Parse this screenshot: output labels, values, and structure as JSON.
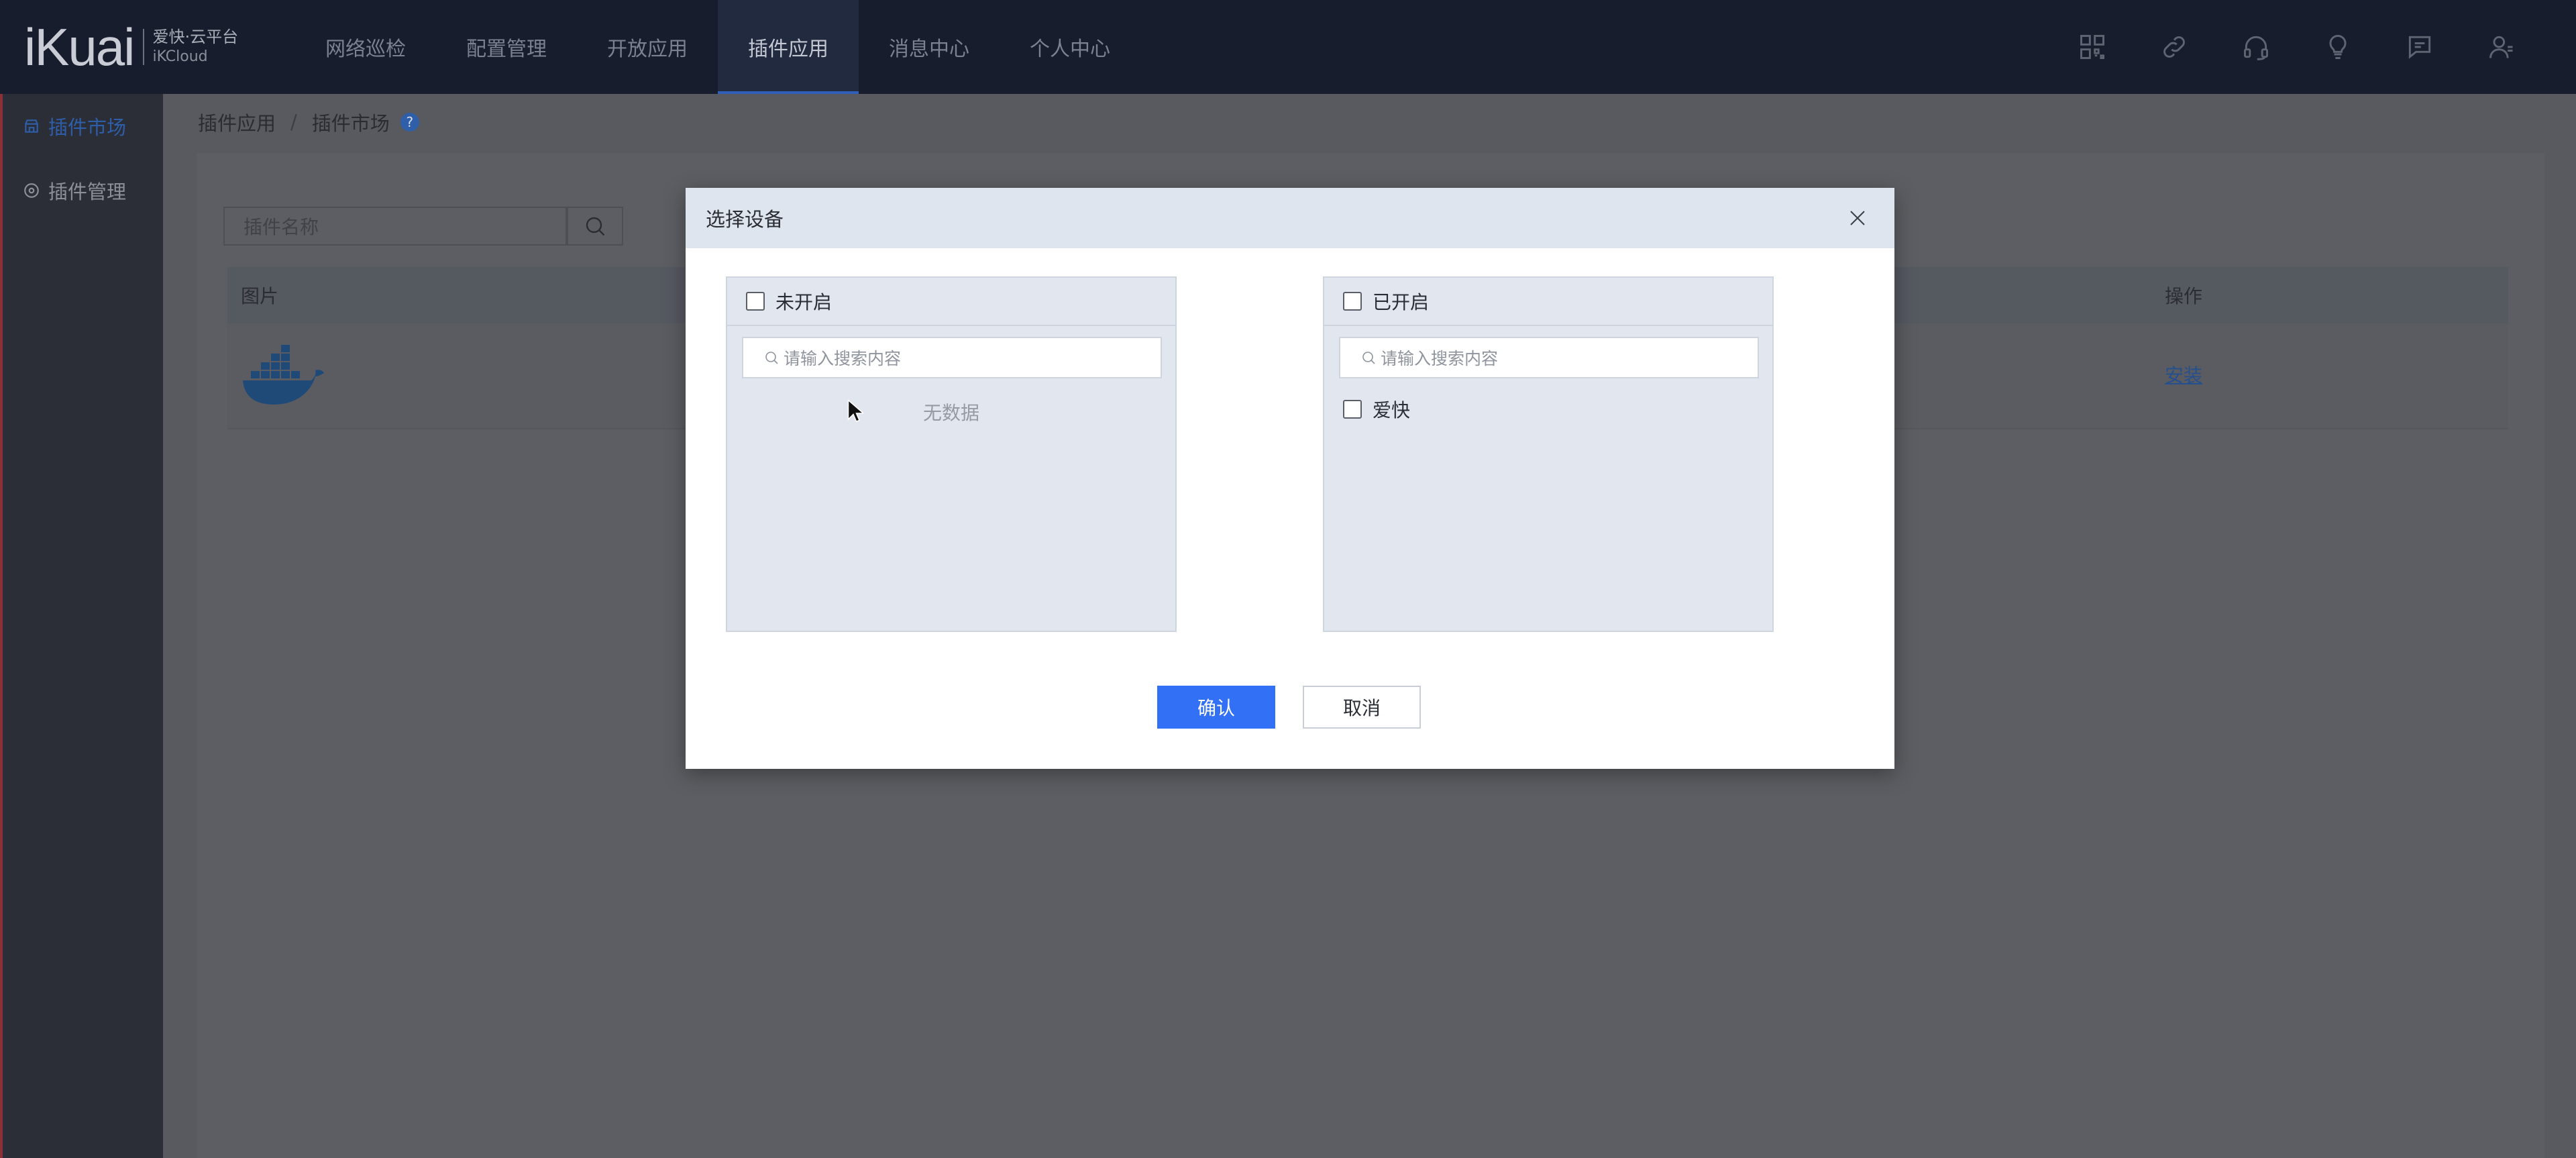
{
  "brand": {
    "logo_text": "iKuai",
    "name_cn": "爱快·云平台",
    "name_en": "iKCloud"
  },
  "nav": {
    "items": [
      {
        "label": "网络巡检",
        "active": false
      },
      {
        "label": "配置管理",
        "active": false
      },
      {
        "label": "开放应用",
        "active": false
      },
      {
        "label": "插件应用",
        "active": true
      },
      {
        "label": "消息中心",
        "active": false
      },
      {
        "label": "个人中心",
        "active": false
      }
    ],
    "icons": [
      "apps-grid-icon",
      "link-icon",
      "headset-icon",
      "lightbulb-icon",
      "message-icon",
      "user-icon"
    ]
  },
  "sidebar": {
    "items": [
      {
        "label": "插件市场",
        "icon": "market-icon",
        "active": true
      },
      {
        "label": "插件管理",
        "icon": "settings-icon",
        "active": false
      }
    ]
  },
  "breadcrumb": {
    "parent": "插件应用",
    "separator": "/",
    "current": "插件市场",
    "help": "?"
  },
  "search": {
    "placeholder": "插件名称"
  },
  "table": {
    "columns": {
      "image": "图片",
      "action": "操作"
    },
    "rows": [
      {
        "image": "docker-whale-icon",
        "action": "安装"
      }
    ]
  },
  "modal": {
    "title": "选择设备",
    "left": {
      "title": "未开启",
      "search_placeholder": "请输入搜索内容",
      "empty_text": "无数据",
      "items": []
    },
    "right": {
      "title": "已开启",
      "search_placeholder": "请输入搜索内容",
      "items": [
        {
          "label": "爱快",
          "checked": false
        }
      ]
    },
    "confirm_label": "确认",
    "cancel_label": "取消"
  },
  "colors": {
    "primary": "#3270f5",
    "topbar": "#181d2d",
    "sidebar": "#2b2e37",
    "overlay": "#5a5b60",
    "modal_header": "#dfe5ef"
  }
}
